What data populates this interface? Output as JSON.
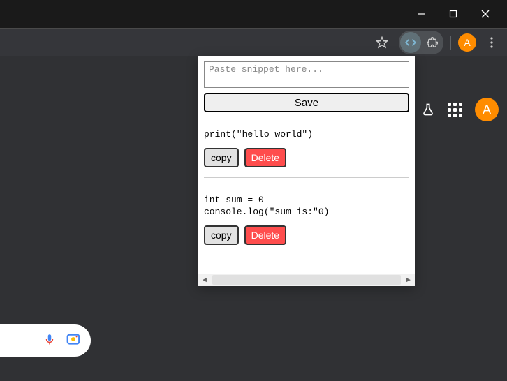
{
  "window": {
    "avatar_letter": "A"
  },
  "popup": {
    "textarea_placeholder": "Paste snippet here...",
    "save_label": "Save",
    "copy_label": "copy",
    "delete_label": "Delete"
  },
  "snippets": [
    {
      "code": "print(\"hello world\")"
    },
    {
      "code": "int sum = 0\nconsole.log(\"sum is:\"0)"
    }
  ],
  "page": {
    "avatar_letter": "A"
  }
}
